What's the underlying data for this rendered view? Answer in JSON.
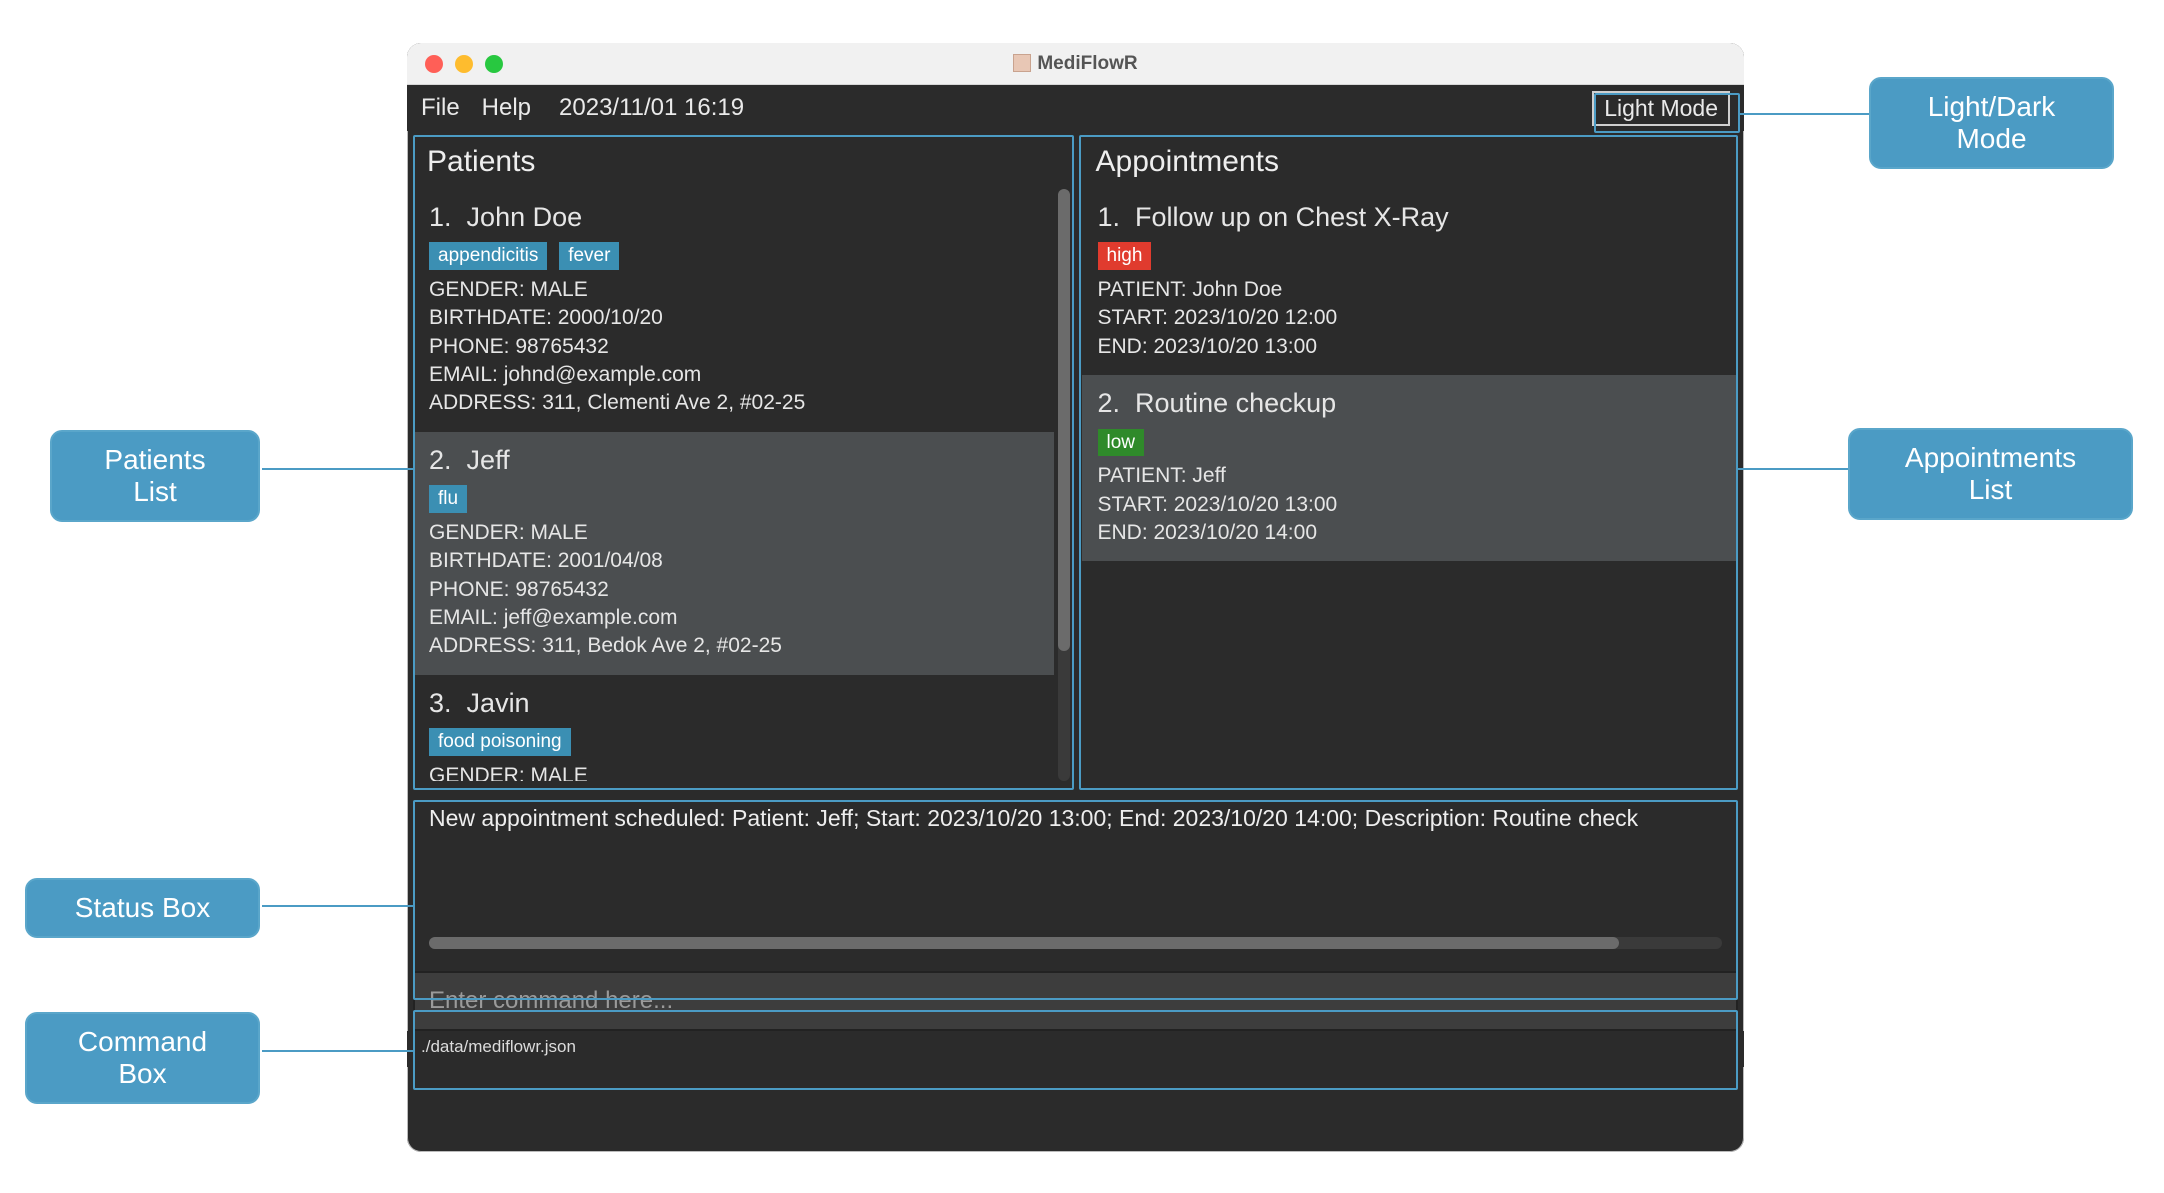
{
  "window": {
    "title": "MediFlowR"
  },
  "menubar": {
    "file": "File",
    "help": "Help",
    "datetime": "2023/11/01 16:19",
    "mode_toggle": "Light Mode"
  },
  "panels": {
    "patients_header": "Patients",
    "appointments_header": "Appointments"
  },
  "patients": [
    {
      "idx": "1.",
      "name": "John Doe",
      "tags": [
        "appendicitis",
        "fever"
      ],
      "gender": "GENDER: MALE",
      "birthdate": "BIRTHDATE: 2000/10/20",
      "phone": "PHONE: 98765432",
      "email": "EMAIL: johnd@example.com",
      "address": "ADDRESS: 311, Clementi Ave 2, #02-25"
    },
    {
      "idx": "2.",
      "name": "Jeff",
      "tags": [
        "flu"
      ],
      "gender": "GENDER: MALE",
      "birthdate": "BIRTHDATE: 2001/04/08",
      "phone": "PHONE: 98765432",
      "email": "EMAIL: jeff@example.com",
      "address": "ADDRESS: 311, Bedok Ave 2, #02-25"
    },
    {
      "idx": "3.",
      "name": "Javin",
      "tags": [
        "food poisoning"
      ],
      "gender": "GENDER: MALE",
      "birthdate": "",
      "phone": "",
      "email": "",
      "address": ""
    }
  ],
  "appointments": [
    {
      "idx": "1.",
      "title": "Follow up on Chest X-Ray",
      "priority": "high",
      "priority_class": "high",
      "patient": "PATIENT: John Doe",
      "start": "START: 2023/10/20 12:00",
      "end": "END: 2023/10/20 13:00"
    },
    {
      "idx": "2.",
      "title": "Routine checkup",
      "priority": "low",
      "priority_class": "low",
      "patient": "PATIENT: Jeff",
      "start": "START: 2023/10/20 13:00",
      "end": "END: 2023/10/20 14:00"
    }
  ],
  "status": {
    "message": "New appointment scheduled: Patient: Jeff; Start: 2023/10/20 13:00; End: 2023/10/20 14:00; Description: Routine check"
  },
  "command": {
    "placeholder": "Enter command here..."
  },
  "footer": {
    "path": "./data/mediflowr.json"
  },
  "callouts": {
    "patients_list": "Patients List",
    "status_box": "Status Box",
    "command_box": "Command Box",
    "mode": "Light/Dark Mode",
    "appointments_list": "Appointments List"
  }
}
